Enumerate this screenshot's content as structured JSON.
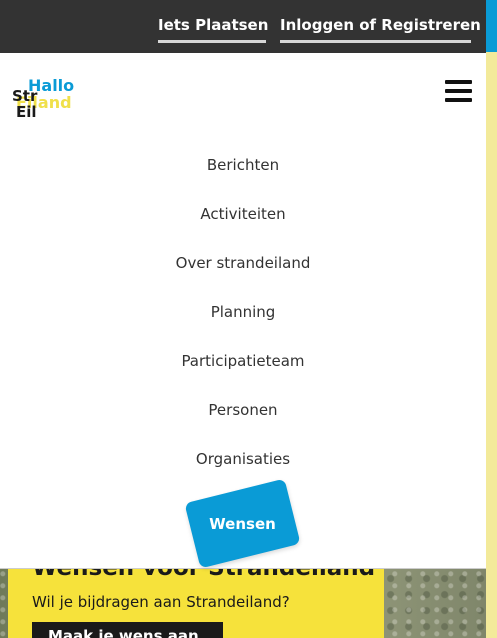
{
  "topbar": {
    "post_label": "Iets Plaatsen",
    "login_label": "Inloggen of Registreren"
  },
  "logo": {
    "word_hallo": "Hallo",
    "word_eiland": "Eiland",
    "word_str": "Str",
    "word_eil": "Eil"
  },
  "nav": {
    "items": [
      {
        "label": "Berichten"
      },
      {
        "label": "Activiteiten"
      },
      {
        "label": "Over strandeiland"
      },
      {
        "label": "Planning"
      },
      {
        "label": "Participatieteam"
      },
      {
        "label": "Personen"
      },
      {
        "label": "Organisaties"
      },
      {
        "label": "Wensen"
      }
    ],
    "active_index": 7
  },
  "hero": {
    "title": "Wensen voor Strandeiland",
    "subtitle": "Wil je bijdragen aan Strandeiland?",
    "button_label": "Maak je wens aan"
  },
  "icons": {
    "menu": "hamburger-menu-icon"
  },
  "colors": {
    "brand_blue": "#0a9bd6",
    "brand_yellow": "#f6e23b",
    "topbar_bg": "#333333"
  }
}
